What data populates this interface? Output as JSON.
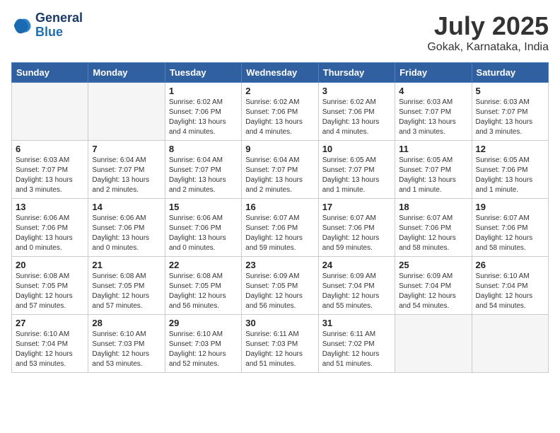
{
  "header": {
    "logo_line1": "General",
    "logo_line2": "Blue",
    "month_year": "July 2025",
    "location": "Gokak, Karnataka, India"
  },
  "weekdays": [
    "Sunday",
    "Monday",
    "Tuesday",
    "Wednesday",
    "Thursday",
    "Friday",
    "Saturday"
  ],
  "weeks": [
    [
      {
        "day": "",
        "info": ""
      },
      {
        "day": "",
        "info": ""
      },
      {
        "day": "1",
        "info": "Sunrise: 6:02 AM\nSunset: 7:06 PM\nDaylight: 13 hours and 4 minutes."
      },
      {
        "day": "2",
        "info": "Sunrise: 6:02 AM\nSunset: 7:06 PM\nDaylight: 13 hours and 4 minutes."
      },
      {
        "day": "3",
        "info": "Sunrise: 6:02 AM\nSunset: 7:06 PM\nDaylight: 13 hours and 4 minutes."
      },
      {
        "day": "4",
        "info": "Sunrise: 6:03 AM\nSunset: 7:07 PM\nDaylight: 13 hours and 3 minutes."
      },
      {
        "day": "5",
        "info": "Sunrise: 6:03 AM\nSunset: 7:07 PM\nDaylight: 13 hours and 3 minutes."
      }
    ],
    [
      {
        "day": "6",
        "info": "Sunrise: 6:03 AM\nSunset: 7:07 PM\nDaylight: 13 hours and 3 minutes."
      },
      {
        "day": "7",
        "info": "Sunrise: 6:04 AM\nSunset: 7:07 PM\nDaylight: 13 hours and 2 minutes."
      },
      {
        "day": "8",
        "info": "Sunrise: 6:04 AM\nSunset: 7:07 PM\nDaylight: 13 hours and 2 minutes."
      },
      {
        "day": "9",
        "info": "Sunrise: 6:04 AM\nSunset: 7:07 PM\nDaylight: 13 hours and 2 minutes."
      },
      {
        "day": "10",
        "info": "Sunrise: 6:05 AM\nSunset: 7:07 PM\nDaylight: 13 hours and 1 minute."
      },
      {
        "day": "11",
        "info": "Sunrise: 6:05 AM\nSunset: 7:07 PM\nDaylight: 13 hours and 1 minute."
      },
      {
        "day": "12",
        "info": "Sunrise: 6:05 AM\nSunset: 7:06 PM\nDaylight: 13 hours and 1 minute."
      }
    ],
    [
      {
        "day": "13",
        "info": "Sunrise: 6:06 AM\nSunset: 7:06 PM\nDaylight: 13 hours and 0 minutes."
      },
      {
        "day": "14",
        "info": "Sunrise: 6:06 AM\nSunset: 7:06 PM\nDaylight: 13 hours and 0 minutes."
      },
      {
        "day": "15",
        "info": "Sunrise: 6:06 AM\nSunset: 7:06 PM\nDaylight: 13 hours and 0 minutes."
      },
      {
        "day": "16",
        "info": "Sunrise: 6:07 AM\nSunset: 7:06 PM\nDaylight: 12 hours and 59 minutes."
      },
      {
        "day": "17",
        "info": "Sunrise: 6:07 AM\nSunset: 7:06 PM\nDaylight: 12 hours and 59 minutes."
      },
      {
        "day": "18",
        "info": "Sunrise: 6:07 AM\nSunset: 7:06 PM\nDaylight: 12 hours and 58 minutes."
      },
      {
        "day": "19",
        "info": "Sunrise: 6:07 AM\nSunset: 7:06 PM\nDaylight: 12 hours and 58 minutes."
      }
    ],
    [
      {
        "day": "20",
        "info": "Sunrise: 6:08 AM\nSunset: 7:05 PM\nDaylight: 12 hours and 57 minutes."
      },
      {
        "day": "21",
        "info": "Sunrise: 6:08 AM\nSunset: 7:05 PM\nDaylight: 12 hours and 57 minutes."
      },
      {
        "day": "22",
        "info": "Sunrise: 6:08 AM\nSunset: 7:05 PM\nDaylight: 12 hours and 56 minutes."
      },
      {
        "day": "23",
        "info": "Sunrise: 6:09 AM\nSunset: 7:05 PM\nDaylight: 12 hours and 56 minutes."
      },
      {
        "day": "24",
        "info": "Sunrise: 6:09 AM\nSunset: 7:04 PM\nDaylight: 12 hours and 55 minutes."
      },
      {
        "day": "25",
        "info": "Sunrise: 6:09 AM\nSunset: 7:04 PM\nDaylight: 12 hours and 54 minutes."
      },
      {
        "day": "26",
        "info": "Sunrise: 6:10 AM\nSunset: 7:04 PM\nDaylight: 12 hours and 54 minutes."
      }
    ],
    [
      {
        "day": "27",
        "info": "Sunrise: 6:10 AM\nSunset: 7:04 PM\nDaylight: 12 hours and 53 minutes."
      },
      {
        "day": "28",
        "info": "Sunrise: 6:10 AM\nSunset: 7:03 PM\nDaylight: 12 hours and 53 minutes."
      },
      {
        "day": "29",
        "info": "Sunrise: 6:10 AM\nSunset: 7:03 PM\nDaylight: 12 hours and 52 minutes."
      },
      {
        "day": "30",
        "info": "Sunrise: 6:11 AM\nSunset: 7:03 PM\nDaylight: 12 hours and 51 minutes."
      },
      {
        "day": "31",
        "info": "Sunrise: 6:11 AM\nSunset: 7:02 PM\nDaylight: 12 hours and 51 minutes."
      },
      {
        "day": "",
        "info": ""
      },
      {
        "day": "",
        "info": ""
      }
    ]
  ]
}
